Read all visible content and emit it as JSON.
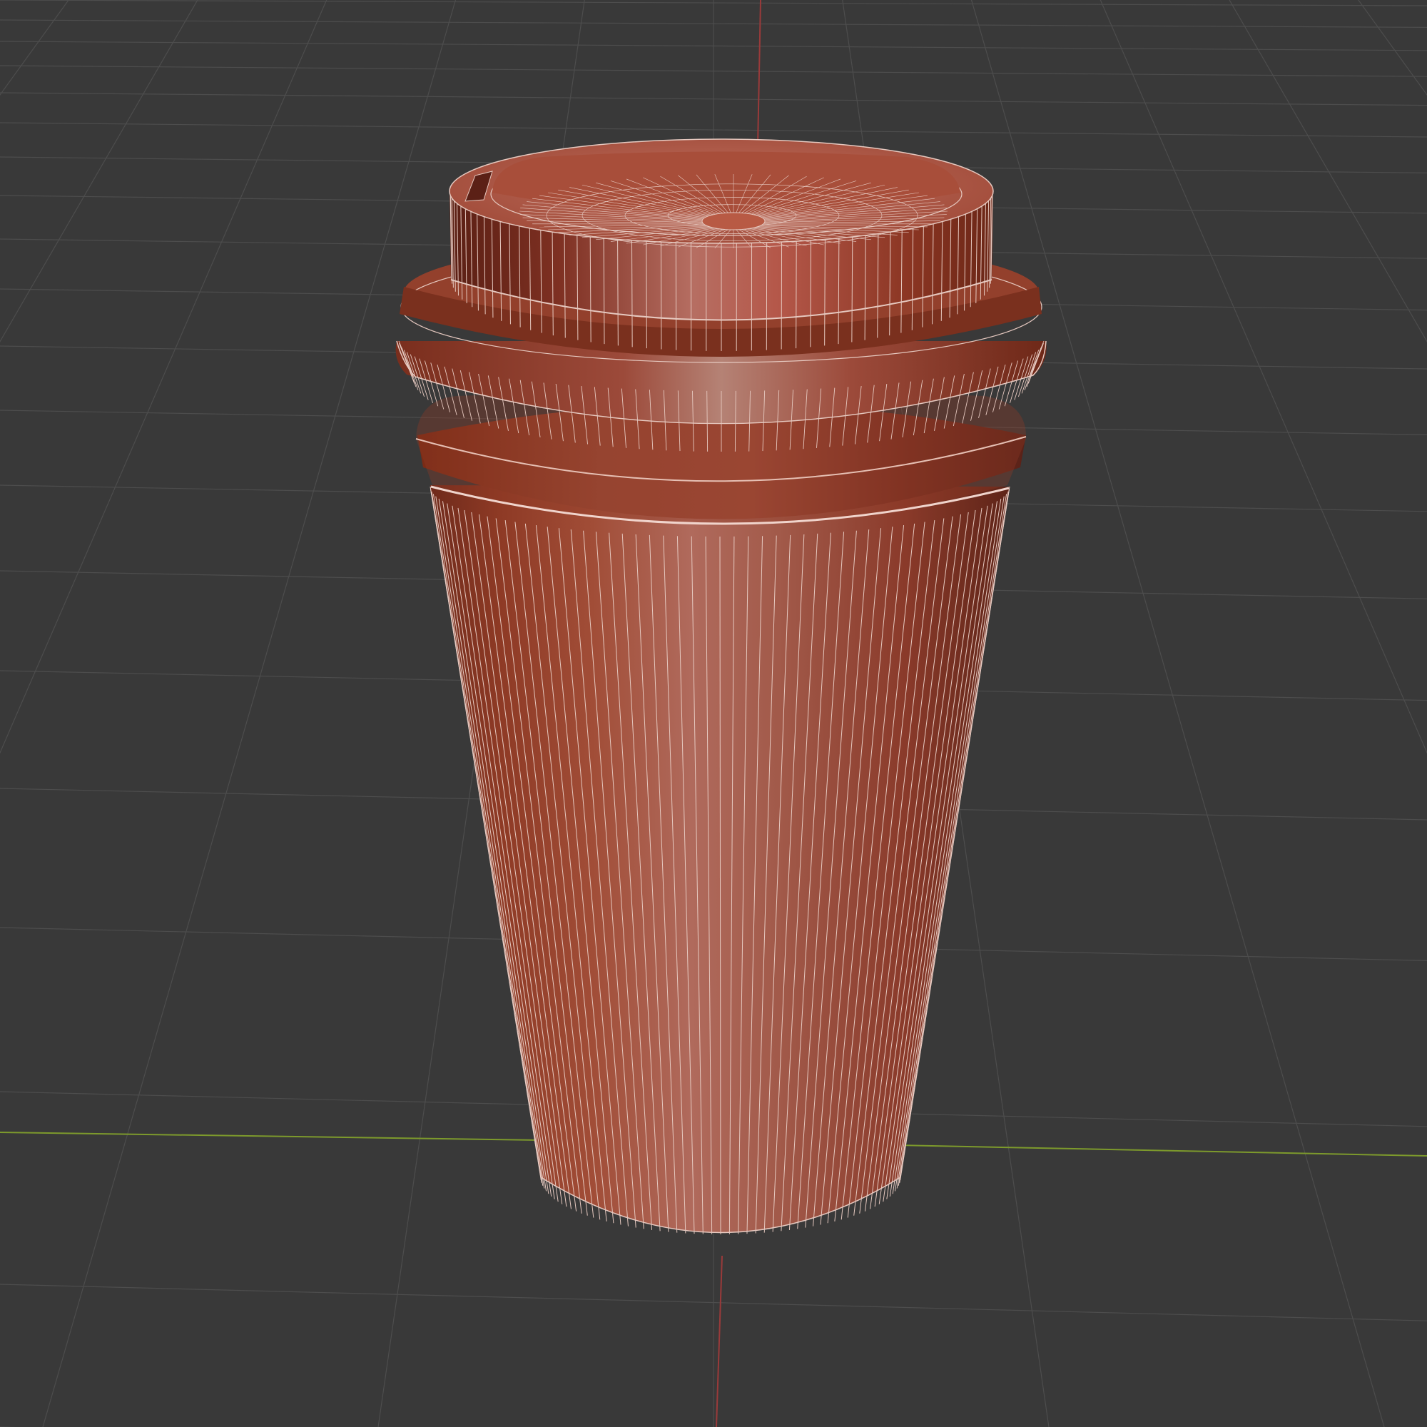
{
  "viewport": {
    "background": "#393939",
    "grid_color": "#4d4d4d",
    "x_axis_color": "#7d9a2c",
    "y_axis_color": "#9a3a3a",
    "wire_color": "#e6c9c0"
  },
  "object": {
    "kind": "paper cup with lid",
    "shading": "solid",
    "overlay": "wireframe",
    "base_color": "#a24a32",
    "highlight_color": "#b86a5a",
    "shadow_color": "#6e2a1c"
  },
  "icons": {
    "grid": "floor-grid",
    "x_axis": "x-axis-line",
    "y_axis": "y-axis-line"
  }
}
